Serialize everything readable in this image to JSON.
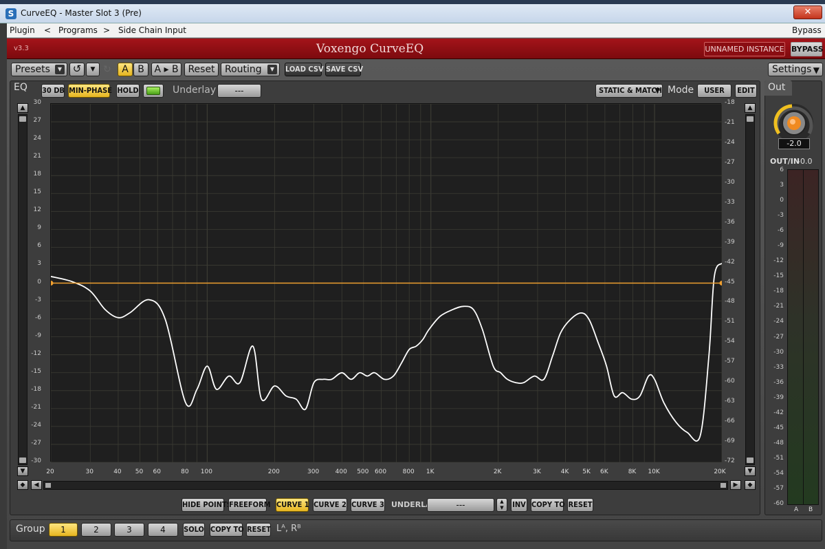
{
  "window": {
    "title": "CurveEQ - Master Slot 3 (Pre)",
    "close_label": "✕"
  },
  "menu": {
    "plugin": "Plugin",
    "prev": "<",
    "programs": "Programs",
    "next": ">",
    "sidechain": "Side Chain Input",
    "bypass": "Bypass"
  },
  "header": {
    "version": "v3.3",
    "name": "Voxengo CurveEQ",
    "instance": "UNNAMED INSTANCE",
    "bypass": "BYPASS"
  },
  "toolbar": {
    "presets": "Presets",
    "a": "A",
    "b": "B",
    "a_to_b": "A ▸ B",
    "reset": "Reset",
    "routing": "Routing",
    "load_csv": "LOAD CSV",
    "save_csv": "SAVE CSV",
    "settings": "Settings"
  },
  "eq_bar": {
    "section": "EQ",
    "range": "30 DB",
    "minphase": "MIN-PHASE",
    "hold": "HOLD",
    "underlay_label": "Underlay",
    "underlay_value": "---",
    "static_match": "STATIC & MATCH",
    "mode_label": "Mode",
    "mode_value": "USER",
    "edit": "EDIT",
    "out_section": "Out"
  },
  "graph": {
    "left_ticks": [
      "30",
      "27",
      "24",
      "21",
      "18",
      "15",
      "12",
      "9",
      "6",
      "3",
      "0",
      "-3",
      "-6",
      "-9",
      "-12",
      "-15",
      "-18",
      "-21",
      "-24",
      "-27",
      "-30"
    ],
    "right_ticks": [
      "-18",
      "-21",
      "-24",
      "-27",
      "-30",
      "-33",
      "-36",
      "-39",
      "-42",
      "-45",
      "-48",
      "-51",
      "-54",
      "-57",
      "-60",
      "-63",
      "-66",
      "-69",
      "-72"
    ],
    "freq_labels": [
      "20",
      "30",
      "40",
      "50",
      "60",
      "80",
      "100",
      "200",
      "300",
      "400",
      "500",
      "600",
      "800",
      "1K",
      "2K",
      "3K",
      "4K",
      "5K",
      "6K",
      "8K",
      "10K",
      "20K"
    ],
    "freq_values": [
      20,
      30,
      40,
      50,
      60,
      80,
      100,
      200,
      300,
      400,
      500,
      600,
      800,
      1000,
      2000,
      3000,
      4000,
      5000,
      6000,
      8000,
      10000,
      20000
    ],
    "colors": {
      "curve": "#ffffff",
      "eq_line": "#f0a030",
      "grid": "#3c3c34",
      "background": "#1f1f1f"
    }
  },
  "chart_data": {
    "type": "line",
    "x_scale": "log",
    "xlim": [
      20,
      20000
    ],
    "y_left_lim": [
      -30,
      30
    ],
    "y_right_lim": [
      -72,
      -18
    ],
    "series": [
      {
        "axis": "right",
        "x": [
          20,
          25,
          30,
          35,
          40,
          45,
          55,
          65,
          80,
          90,
          100,
          110,
          125,
          140,
          160,
          175,
          200,
          225,
          250,
          275,
          300,
          330,
          360,
          400,
          440,
          480,
          520,
          560,
          620,
          680,
          740,
          800,
          860,
          920,
          980,
          1100,
          1250,
          1400,
          1550,
          1700,
          1900,
          2050,
          2200,
          2400,
          2600,
          2900,
          3200,
          3500,
          3800,
          4200,
          4700,
          5100,
          5600,
          6100,
          6600,
          7200,
          7900,
          8600,
          9400,
          10000,
          11000,
          12500,
          14000,
          16000,
          17500,
          18500,
          20000
        ],
        "y": [
          -44.0,
          -44.8,
          -46.2,
          -49.0,
          -50.2,
          -49.5,
          -47.5,
          -50.5,
          -63.0,
          -61.0,
          -57.5,
          -61.0,
          -59.0,
          -60.0,
          -54.5,
          -62.5,
          -60.5,
          -62.0,
          -62.5,
          -64.0,
          -60.0,
          -59.5,
          -59.5,
          -58.5,
          -59.5,
          -58.5,
          -59.0,
          -58.5,
          -59.5,
          -59.0,
          -57.0,
          -55.0,
          -54.5,
          -53.5,
          -52.0,
          -50.0,
          -49.0,
          -48.5,
          -49.0,
          -52.0,
          -57.5,
          -58.5,
          -59.5,
          -60.0,
          -60.0,
          -59.0,
          -59.5,
          -56.0,
          -52.5,
          -50.5,
          -49.5,
          -50.5,
          -54.0,
          -57.5,
          -62.0,
          -61.5,
          -62.5,
          -62.0,
          -59.0,
          -59.5,
          -63.0,
          -66.0,
          -67.5,
          -68.0,
          -56.0,
          -44.0,
          -42.0
        ]
      },
      {
        "axis": "left",
        "x": [
          20,
          20000
        ],
        "y": [
          0,
          0
        ]
      }
    ]
  },
  "bottom_controls": {
    "hide_points": "HIDE POINTS",
    "freeform": "FREEFORM",
    "curve1": "CURVE 1",
    "curve2": "CURVE 2",
    "curve3": "CURVE 3",
    "underlay": "UNDERLAY",
    "underlay_value": "---",
    "inv": "INV",
    "copy_to": "COPY TO",
    "reset": "RESET"
  },
  "group_bar": {
    "label": "Group",
    "g1": "1",
    "g2": "2",
    "g3": "3",
    "g4": "4",
    "solo": "SOLO",
    "copy_to": "COPY TO",
    "reset": "RESET",
    "channels": "Lᴬ, Rᴮ"
  },
  "out": {
    "knob_value": "-2.0",
    "out_in_label": "OUT/IN",
    "out_in_value": "-0.0",
    "meter_ticks": [
      "6",
      "3",
      "0",
      "-3",
      "-6",
      "-9",
      "-12",
      "-15",
      "-18",
      "-21",
      "-24",
      "-27",
      "-30",
      "-33",
      "-36",
      "-39",
      "-42",
      "-45",
      "-48",
      "-51",
      "-54",
      "-57",
      "-60"
    ],
    "channels": [
      "A",
      "B"
    ]
  }
}
